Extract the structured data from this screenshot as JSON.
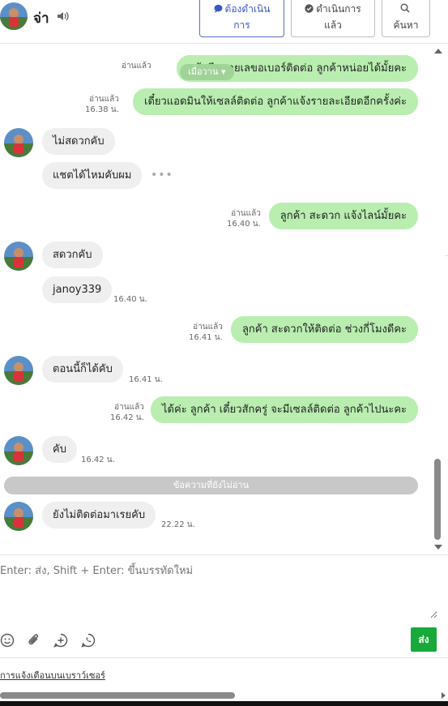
{
  "header": {
    "name": "จ่า",
    "buttons": [
      {
        "label_line1": "ต้องดำเนิน",
        "label_line2": "การ",
        "icon": "speech-bubble-icon"
      },
      {
        "label_line1": "ดำเนินการ",
        "label_line2": "แล้ว",
        "icon": "check-circle-icon"
      },
      {
        "label_line1": "",
        "label_line2": "ค้นหา",
        "icon": "search-icon"
      }
    ]
  },
  "chat": {
    "read_badge": "เมื่อวาน ▾",
    "unread_divider": "ข้อความที่ยังไม่อ่าน",
    "messages": [
      {
        "dir": "out",
        "text": "แล้วมีหมายเลขอเบอร์ติดต่อ ลูกค้าหน่อยได้มั้ยคะ",
        "status": "อ่านแล้ว",
        "time": ""
      },
      {
        "dir": "out",
        "text": "เดี๋ยวแอดมินให้เซลล์ติดต่อ ลูกค้าแจ้งรายละเอียดอีกครั้งค่ะ",
        "status": "อ่านแล้ว",
        "time": "16.38 น."
      },
      {
        "dir": "in",
        "text": "ไม่สดวกคับ",
        "time": ""
      },
      {
        "dir": "in",
        "text": "แชตได้ไหมคับผม",
        "time": ""
      },
      {
        "dir": "out",
        "text": "ลูกค้า สะดวก แจ้งไลน์มั้ยคะ",
        "status": "อ่านแล้ว",
        "time": "16.40 น."
      },
      {
        "dir": "in",
        "text": "สดวกคับ",
        "time": ""
      },
      {
        "dir": "in",
        "text": "janoy339",
        "time": "16.40 น."
      },
      {
        "dir": "out",
        "text": "ลูกค้า สะดวกให้ติดต่อ ช่วงกี่โมงดีคะ",
        "status": "อ่านแล้ว",
        "time": "16.41 น."
      },
      {
        "dir": "in",
        "text": "ตอนนี้ก็ได้คับ",
        "time": "16.41 น."
      },
      {
        "dir": "out",
        "text": "ได้ค่ะ ลูกค้า เดี๋ยวสักครู่ จะมีเซลล์ติดต่อ ลูกค้าไปนะคะ",
        "status": "อ่านแล้ว",
        "time": "16.42 น."
      },
      {
        "dir": "in",
        "text": "คับ",
        "time": "16.42 น."
      },
      {
        "dir": "in",
        "text": "ยังไม่ติดต่อมาเรยคับ",
        "time": "22.22 น."
      }
    ],
    "more_dots": "•••"
  },
  "composer": {
    "placeholder": "Enter: ส่ง, Shift + Enter: ขึ้นบรรทัดใหม่",
    "send_label": "ส่ง",
    "tools": [
      "emoji-icon",
      "attachment-icon",
      "add-circle-icon",
      "whatsapp-icon"
    ]
  },
  "footer": {
    "notify_link": "การแจ้งเตือนบนเบราว์เซอร์"
  },
  "colors": {
    "outgoing_bubble": "#b9eeb0",
    "incoming_bubble": "#efefef",
    "send_button": "#17a93a",
    "accent_button": "#3a56c4"
  }
}
